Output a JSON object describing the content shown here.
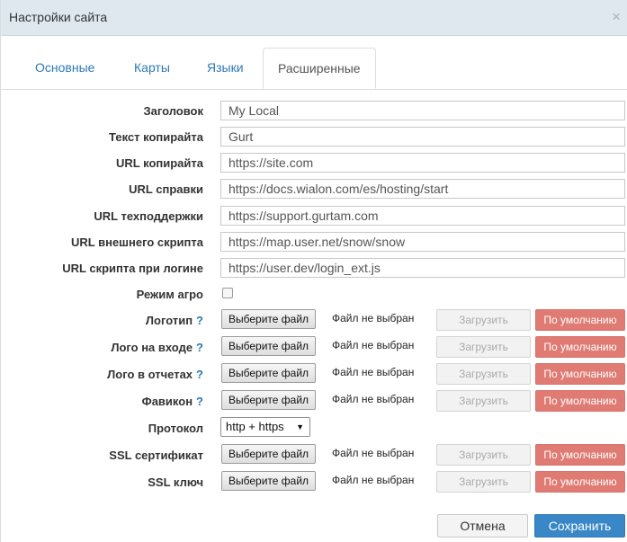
{
  "dialog": {
    "title": "Настройки сайта",
    "close_glyph": "×"
  },
  "tabs": [
    {
      "label": "Основные",
      "active": false
    },
    {
      "label": "Карты",
      "active": false
    },
    {
      "label": "Языки",
      "active": false
    },
    {
      "label": "Расширенные",
      "active": true
    }
  ],
  "fields": {
    "title": {
      "label": "Заголовок",
      "value": "My Local"
    },
    "copyright_text": {
      "label": "Текст копирайта",
      "value": "Gurt"
    },
    "copyright_url": {
      "label": "URL копирайта",
      "value": "https://site.com"
    },
    "help_url": {
      "label": "URL справки",
      "value": "https://docs.wialon.com/es/hosting/start"
    },
    "support_url": {
      "label": "URL техподдержки",
      "value": "https://support.gurtam.com"
    },
    "external_script_url": {
      "label": "URL внешнего скрипта",
      "value": "https://map.user.net/snow/snow"
    },
    "login_script_url": {
      "label": "URL скрипта при логине",
      "value": "https://user.dev/login_ext.js"
    },
    "agro_mode": {
      "label": "Режим агро",
      "checked": false
    }
  },
  "file_rows": {
    "logo": {
      "label": "Логотип",
      "help": "?",
      "choose": "Выберите файл",
      "status": "Файл не выбран",
      "upload": "Загрузить",
      "default": "По умолчанию"
    },
    "login_logo": {
      "label": "Лого на входе",
      "help": "?",
      "choose": "Выберите файл",
      "status": "Файл не выбран",
      "upload": "Загрузить",
      "default": "По умолчанию"
    },
    "report_logo": {
      "label": "Лого в отчетах",
      "help": "?",
      "choose": "Выберите файл",
      "status": "Файл не выбран",
      "upload": "Загрузить",
      "default": "По умолчанию"
    },
    "favicon": {
      "label": "Фавикон",
      "help": "?",
      "choose": "Выберите файл",
      "status": "Файл не выбран",
      "upload": "Загрузить",
      "default": "По умолчанию"
    },
    "ssl_cert": {
      "label": "SSL сертификат",
      "choose": "Выберите файл",
      "status": "Файл не выбран",
      "upload": "Загрузить",
      "default": "По умолчанию"
    },
    "ssl_key": {
      "label": "SSL ключ",
      "choose": "Выберите файл",
      "status": "Файл не выбран",
      "upload": "Загрузить",
      "default": "По умолчанию"
    }
  },
  "protocol": {
    "label": "Протокол",
    "value": "http + https",
    "arrow": "▼"
  },
  "footer": {
    "cancel": "Отмена",
    "save": "Сохранить"
  },
  "colors": {
    "accent": "#3a87c7",
    "danger": "#e07b73",
    "titlebar": "#dfe8ef"
  }
}
